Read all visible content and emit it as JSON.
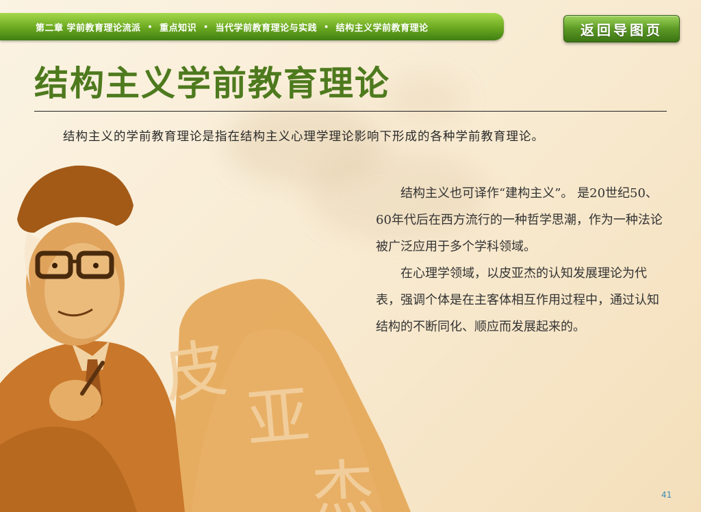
{
  "nav": {
    "breadcrumb": [
      "第二章 学前教育理论流派",
      "重点知识",
      "当代学前教育理论与实践",
      "结构主义学前教育理论"
    ],
    "separator": "•",
    "back_button": "返回导图页"
  },
  "title": "结构主义学前教育理论",
  "intro": "结构主义的学前教育理论是指在结构主义心理学理论影响下形成的各种学前教育理论。",
  "body": {
    "paragraphs": [
      "结构主义也可译作“建构主义”。 是20世纪50、60年代后在西方流行的一种哲学思潮，作为一种法论被广泛应用于多个学科领域。",
      "在心理学领域，以皮亚杰的认知发展理论为代表，强调个体是在主客体相互作用过程中，通过认知结构的不断同化、顺应而发展起来的。"
    ]
  },
  "portrait": {
    "calligraphy": [
      "皮",
      "亚",
      "杰"
    ],
    "colors": {
      "ink": "#c77a22",
      "ink_light": "#dd9b45",
      "wash": "#e6aa55"
    }
  },
  "page_number": "41"
}
